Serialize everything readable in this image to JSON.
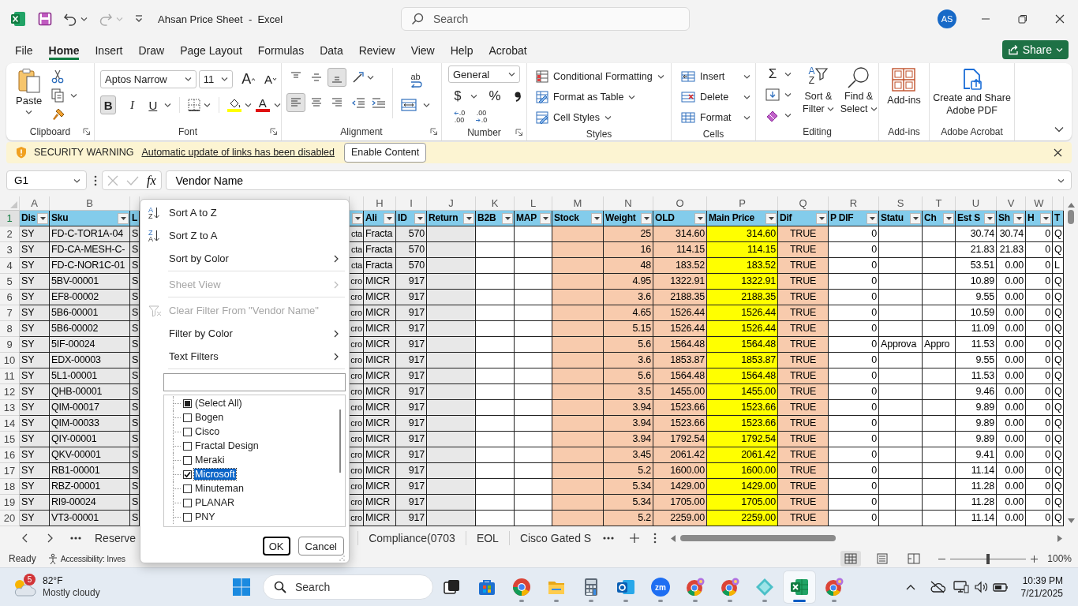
{
  "title_bar": {
    "title": "Ahsan Price Sheet  -  Excel",
    "search": {
      "placeholder": "Search"
    },
    "account": "AS"
  },
  "menu_tabs": [
    {
      "label": "File",
      "selected": false
    },
    {
      "label": "Home",
      "selected": true
    },
    {
      "label": "Insert",
      "selected": false
    },
    {
      "label": "Draw",
      "selected": false
    },
    {
      "label": "Page Layout",
      "selected": false
    },
    {
      "label": "Formulas",
      "selected": false
    },
    {
      "label": "Data",
      "selected": false
    },
    {
      "label": "Review",
      "selected": false
    },
    {
      "label": "View",
      "selected": false
    },
    {
      "label": "Help",
      "selected": false
    },
    {
      "label": "Acrobat",
      "selected": false
    }
  ],
  "share_button": "Share",
  "ribbon": {
    "clipboard": {
      "label": "Clipboard",
      "paste": "Paste"
    },
    "font": {
      "label": "Font",
      "name": "Aptos Narrow",
      "size": "11",
      "grow": "A",
      "shrink": "A",
      "bold": {
        "text": "B",
        "on": true
      },
      "italic": {
        "text": "I",
        "on": false
      },
      "underline": {
        "text": "U",
        "on": false
      },
      "color_letter": "A"
    },
    "alignment": {
      "label": "Alignment",
      "wrap_text": "ab",
      "vertical": [
        {
          "on": false
        },
        {
          "on": false
        },
        {
          "on": true
        }
      ],
      "horizontal": [
        {
          "on": true
        },
        {
          "on": false
        },
        {
          "on": false
        }
      ]
    },
    "number": {
      "label": "Number",
      "format": "General",
      "currency": "$",
      "percent": "%",
      "decimals": [
        {
          "top": ".0",
          "bottom": ".00"
        },
        {
          "top": ".00",
          "bottom": ".0"
        }
      ]
    },
    "styles": {
      "label": "Styles",
      "items": [
        "Conditional Formatting",
        "Format as Table",
        "Cell Styles"
      ]
    },
    "cells": {
      "label": "Cells",
      "items": [
        "Insert",
        "Delete",
        "Format"
      ]
    },
    "editing": {
      "label": "Editing",
      "autosum": "Σ",
      "sort_letters": [
        "A",
        "Z"
      ],
      "sort_filter": [
        "Sort &",
        "Filter"
      ],
      "find_select": [
        "Find &",
        "Select"
      ]
    },
    "addins": {
      "label": "Add-ins",
      "button": "Add-ins"
    },
    "acrobat": {
      "label": "Adobe Acrobat",
      "button": [
        "Create and Share",
        "Adobe PDF"
      ]
    }
  },
  "security_bar": {
    "title": "SECURITY WARNING",
    "message": "Automatic update of links has been disabled",
    "button": "Enable Content"
  },
  "formula_bar": {
    "name_box": "G1",
    "fx": "fx",
    "formula": "Vendor Name"
  },
  "sheet": {
    "columns": [
      {
        "letter": "A",
        "header": "Dis",
        "filter": true,
        "color": "#e8e8e8"
      },
      {
        "letter": "B",
        "header": "Sku",
        "filter": true,
        "color": "#e8e8e8"
      },
      {
        "header": "L",
        "filter": false,
        "color": "#e8e8e8"
      },
      {
        "filter": true,
        "color": "#e8e8e8"
      },
      {
        "letter": "H",
        "header": "Ali",
        "filter": true,
        "color": "#e8e8e8"
      },
      {
        "letter": "I",
        "header": "ID",
        "filter": true,
        "color": "#e8e8e8"
      },
      {
        "letter": "J",
        "header": "Return",
        "filter": true,
        "color": "#e8e8e8"
      },
      {
        "letter": "K",
        "header": "B2B",
        "filter": true,
        "color": "#ffffff"
      },
      {
        "letter": "L",
        "header": "MAP",
        "filter": true,
        "color": "#ffffff"
      },
      {
        "letter": "M",
        "header": "Stock",
        "filter": true,
        "color": "#f8cbad"
      },
      {
        "letter": "N",
        "header": "Weight",
        "filter": true,
        "color": "#f8cbad"
      },
      {
        "letter": "O",
        "header": "OLD",
        "filter": true,
        "color": "#f8cbad"
      },
      {
        "letter": "P",
        "header": "Main Price",
        "filter": true,
        "color": "#ffff00"
      },
      {
        "letter": "Q",
        "header": "Dif",
        "filter": true,
        "color": "#f8cbad"
      },
      {
        "letter": "R",
        "header": "P DIF",
        "filter": true,
        "color": "#ffffff"
      },
      {
        "letter": "S",
        "header": "Statu",
        "filter": true,
        "color": "#ffffff"
      },
      {
        "letter": "T",
        "header": "Ch",
        "filter": true,
        "color": "#ffffff"
      },
      {
        "letter": "U",
        "header": "Est S",
        "filter": true,
        "color": "#ffffff"
      },
      {
        "letter": "V",
        "header": "Sh",
        "filter": true,
        "color": "#ffffff"
      },
      {
        "letter": "W",
        "header": "H",
        "filter": true,
        "color": "#ffffff"
      },
      {
        "header": "T",
        "filter": false,
        "color": "#ffffff"
      }
    ],
    "header_row": "1",
    "rows": [
      {
        "number": "2",
        "cells": [
          "SY",
          "FD-C-TOR1A-04",
          "S",
          "cta",
          "Fracta",
          "570",
          null,
          null,
          null,
          null,
          "25",
          "314.60",
          "314.60",
          "TRUE",
          "0",
          null,
          null,
          "30.74",
          "30.74",
          "0",
          "Q"
        ]
      },
      {
        "number": "3",
        "cells": [
          "SY",
          "FD-CA-MESH-C-",
          "S",
          "cta",
          "Fracta",
          "570",
          null,
          null,
          null,
          null,
          "16",
          "114.15",
          "114.15",
          "TRUE",
          "0",
          null,
          null,
          "21.83",
          "21.83",
          "0",
          "Q"
        ]
      },
      {
        "number": "4",
        "cells": [
          "SY",
          "FD-C-NOR1C-01",
          "S",
          "cta",
          "Fracta",
          "570",
          null,
          null,
          null,
          null,
          "48",
          "183.52",
          "183.52",
          "TRUE",
          "0",
          null,
          null,
          "53.51",
          "0.00",
          "0",
          "L"
        ]
      },
      {
        "number": "5",
        "cells": [
          "SY",
          "5BV-00001",
          "S",
          "cro",
          "MICR",
          "917",
          null,
          null,
          null,
          null,
          "4.95",
          "1322.91",
          "1322.91",
          "TRUE",
          "0",
          null,
          null,
          "10.89",
          "0.00",
          "0",
          "Q"
        ]
      },
      {
        "number": "6",
        "cells": [
          "SY",
          "EF8-00002",
          "S",
          "cro",
          "MICR",
          "917",
          null,
          null,
          null,
          null,
          "3.6",
          "2188.35",
          "2188.35",
          "TRUE",
          "0",
          null,
          null,
          "9.55",
          "0.00",
          "0",
          "Q"
        ]
      },
      {
        "number": "7",
        "cells": [
          "SY",
          "5B6-00001",
          "S",
          "cro",
          "MICR",
          "917",
          null,
          null,
          null,
          null,
          "4.65",
          "1526.44",
          "1526.44",
          "TRUE",
          "0",
          null,
          null,
          "10.59",
          "0.00",
          "0",
          "Q"
        ]
      },
      {
        "number": "8",
        "cells": [
          "SY",
          "5B6-00002",
          "S",
          "cro",
          "MICR",
          "917",
          null,
          null,
          null,
          null,
          "5.15",
          "1526.44",
          "1526.44",
          "TRUE",
          "0",
          null,
          null,
          "11.09",
          "0.00",
          "0",
          "Q"
        ]
      },
      {
        "number": "9",
        "cells": [
          "SY",
          "5IF-00024",
          "S",
          "cro",
          "MICR",
          "917",
          null,
          null,
          null,
          null,
          "5.6",
          "1564.48",
          "1564.48",
          "TRUE",
          "0",
          "Approva",
          "Appro",
          "11.53",
          "0.00",
          "0",
          "Q"
        ]
      },
      {
        "number": "10",
        "cells": [
          "SY",
          "EDX-00003",
          "S",
          "cro",
          "MICR",
          "917",
          null,
          null,
          null,
          null,
          "3.6",
          "1853.87",
          "1853.87",
          "TRUE",
          "0",
          null,
          null,
          "9.55",
          "0.00",
          "0",
          "Q"
        ]
      },
      {
        "number": "11",
        "cells": [
          "SY",
          "5L1-00001",
          "S",
          "cro",
          "MICR",
          "917",
          null,
          null,
          null,
          null,
          "5.6",
          "1564.48",
          "1564.48",
          "TRUE",
          "0",
          null,
          null,
          "11.53",
          "0.00",
          "0",
          "Q"
        ]
      },
      {
        "number": "12",
        "cells": [
          "SY",
          "QHB-00001",
          "S",
          "cro",
          "MICR",
          "917",
          null,
          null,
          null,
          null,
          "3.5",
          "1455.00",
          "1455.00",
          "TRUE",
          "0",
          null,
          null,
          "9.46",
          "0.00",
          "0",
          "Q"
        ]
      },
      {
        "number": "13",
        "cells": [
          "SY",
          "QIM-00017",
          "S",
          "cro",
          "MICR",
          "917",
          null,
          null,
          null,
          null,
          "3.94",
          "1523.66",
          "1523.66",
          "TRUE",
          "0",
          null,
          null,
          "9.89",
          "0.00",
          "0",
          "Q"
        ]
      },
      {
        "number": "14",
        "cells": [
          "SY",
          "QIM-00033",
          "S",
          "cro",
          "MICR",
          "917",
          null,
          null,
          null,
          null,
          "3.94",
          "1523.66",
          "1523.66",
          "TRUE",
          "0",
          null,
          null,
          "9.89",
          "0.00",
          "0",
          "Q"
        ]
      },
      {
        "number": "15",
        "cells": [
          "SY",
          "QIY-00001",
          "S",
          "cro",
          "MICR",
          "917",
          null,
          null,
          null,
          null,
          "3.94",
          "1792.54",
          "1792.54",
          "TRUE",
          "0",
          null,
          null,
          "9.89",
          "0.00",
          "0",
          "Q"
        ]
      },
      {
        "number": "16",
        "cells": [
          "SY",
          "QKV-00001",
          "S",
          "cro",
          "MICR",
          "917",
          null,
          null,
          null,
          null,
          "3.45",
          "2061.42",
          "2061.42",
          "TRUE",
          "0",
          null,
          null,
          "9.41",
          "0.00",
          "0",
          "Q"
        ]
      },
      {
        "number": "17",
        "cells": [
          "SY",
          "RB1-00001",
          "S",
          "cro",
          "MICR",
          "917",
          null,
          null,
          null,
          null,
          "5.2",
          "1600.00",
          "1600.00",
          "TRUE",
          "0",
          null,
          null,
          "11.14",
          "0.00",
          "0",
          "Q"
        ]
      },
      {
        "number": "18",
        "cells": [
          "SY",
          "RBZ-00001",
          "S",
          "cro",
          "MICR",
          "917",
          null,
          null,
          null,
          null,
          "5.34",
          "1429.00",
          "1429.00",
          "TRUE",
          "0",
          null,
          null,
          "11.28",
          "0.00",
          "0",
          "Q"
        ]
      },
      {
        "number": "19",
        "cells": [
          "SY",
          "RI9-00024",
          "S",
          "cro",
          "MICR",
          "917",
          null,
          null,
          null,
          null,
          "5.34",
          "1705.00",
          "1705.00",
          "TRUE",
          "0",
          null,
          null,
          "11.28",
          "0.00",
          "0",
          "Q"
        ]
      },
      {
        "number": "20",
        "cells": [
          "SY",
          "VT3-00001",
          "S",
          "cro",
          "MICR",
          "917",
          null,
          null,
          null,
          null,
          "5.2",
          "2259.00",
          "2259.00",
          "TRUE",
          "0",
          null,
          null,
          "11.14",
          "0.00",
          "0",
          "Q"
        ]
      }
    ]
  },
  "filter_menu": {
    "items": [
      {
        "kind": "sort-asc",
        "label": "Sort A to Z",
        "icon_letters": [
          "A",
          "Z"
        ],
        "disabled": false,
        "submenu": false
      },
      {
        "kind": "sort-desc",
        "label": "Sort Z to A",
        "icon_letters": [
          "Z",
          "A"
        ],
        "disabled": false,
        "submenu": false
      },
      {
        "kind": "command",
        "label": "Sort by Color",
        "disabled": false,
        "submenu": true
      },
      {
        "kind": "separator"
      },
      {
        "kind": "command",
        "label": "Sheet View",
        "disabled": true,
        "submenu": true
      },
      {
        "kind": "separator"
      },
      {
        "kind": "clear-filter",
        "label": "Clear Filter From \"Vendor Name\"",
        "disabled": true,
        "submenu": false
      },
      {
        "kind": "command",
        "label": "Filter by Color",
        "disabled": false,
        "submenu": true
      },
      {
        "kind": "command",
        "label": "Text Filters",
        "disabled": false,
        "submenu": true
      },
      {
        "kind": "separator"
      }
    ],
    "values": [
      {
        "label": "(Select All)",
        "checked": false,
        "mixed": true,
        "selected": false
      },
      {
        "label": "Bogen",
        "checked": false,
        "mixed": false,
        "selected": false
      },
      {
        "label": "Cisco",
        "checked": false,
        "mixed": false,
        "selected": false
      },
      {
        "label": "Fractal Design",
        "checked": false,
        "mixed": false,
        "selected": false
      },
      {
        "label": "Meraki",
        "checked": false,
        "mixed": false,
        "selected": false
      },
      {
        "label": "Microsoft",
        "checked": true,
        "mixed": false,
        "selected": true
      },
      {
        "label": "Minuteman",
        "checked": false,
        "mixed": false,
        "selected": false
      },
      {
        "label": "PLANAR",
        "checked": false,
        "mixed": false,
        "selected": false
      },
      {
        "label": "PNY",
        "checked": false,
        "mixed": false,
        "selected": false
      }
    ],
    "buttons": [
      {
        "label": "OK",
        "focused": true
      },
      {
        "label": "Cancel",
        "focused": false
      }
    ]
  },
  "sheet_tabs": [
    "Reserve",
    "Compliance(0703",
    "EOL",
    "Cisco Gated S"
  ],
  "status_bar": {
    "mode": "Ready",
    "accessibility": "Accessibility: Inves",
    "views": [
      {
        "selected": true
      },
      {
        "selected": false
      },
      {
        "selected": false
      }
    ],
    "zoom": {
      "level": 0.5
    },
    "zoom_percent": "100%"
  },
  "taskbar": {
    "weather": {
      "badge": "5",
      "temperature": "82°F",
      "condition": "Mostly cloudy"
    },
    "search": {
      "placeholder": "Search"
    },
    "apps": [
      {
        "kind": "task-view",
        "running": false,
        "active": false
      },
      {
        "kind": "store",
        "running": false,
        "active": false
      },
      {
        "kind": "chrome",
        "running": true,
        "active": false
      },
      {
        "kind": "folder",
        "running": true,
        "active": false
      },
      {
        "kind": "calculator",
        "running": true,
        "active": false
      },
      {
        "kind": "mail",
        "running": true,
        "active": false
      },
      {
        "kind": "zoom",
        "label": "zm",
        "running": true,
        "active": false
      },
      {
        "kind": "chrome-badge",
        "running": true,
        "active": false
      },
      {
        "kind": "chrome-badge",
        "running": true,
        "active": false
      },
      {
        "kind": "diamond",
        "running": true,
        "active": false
      },
      {
        "kind": "excel",
        "running": true,
        "active": true
      },
      {
        "kind": "chrome-badge",
        "running": true,
        "active": false
      }
    ],
    "clock": {
      "time": "10:39 PM",
      "date": "7/21/2025"
    }
  }
}
